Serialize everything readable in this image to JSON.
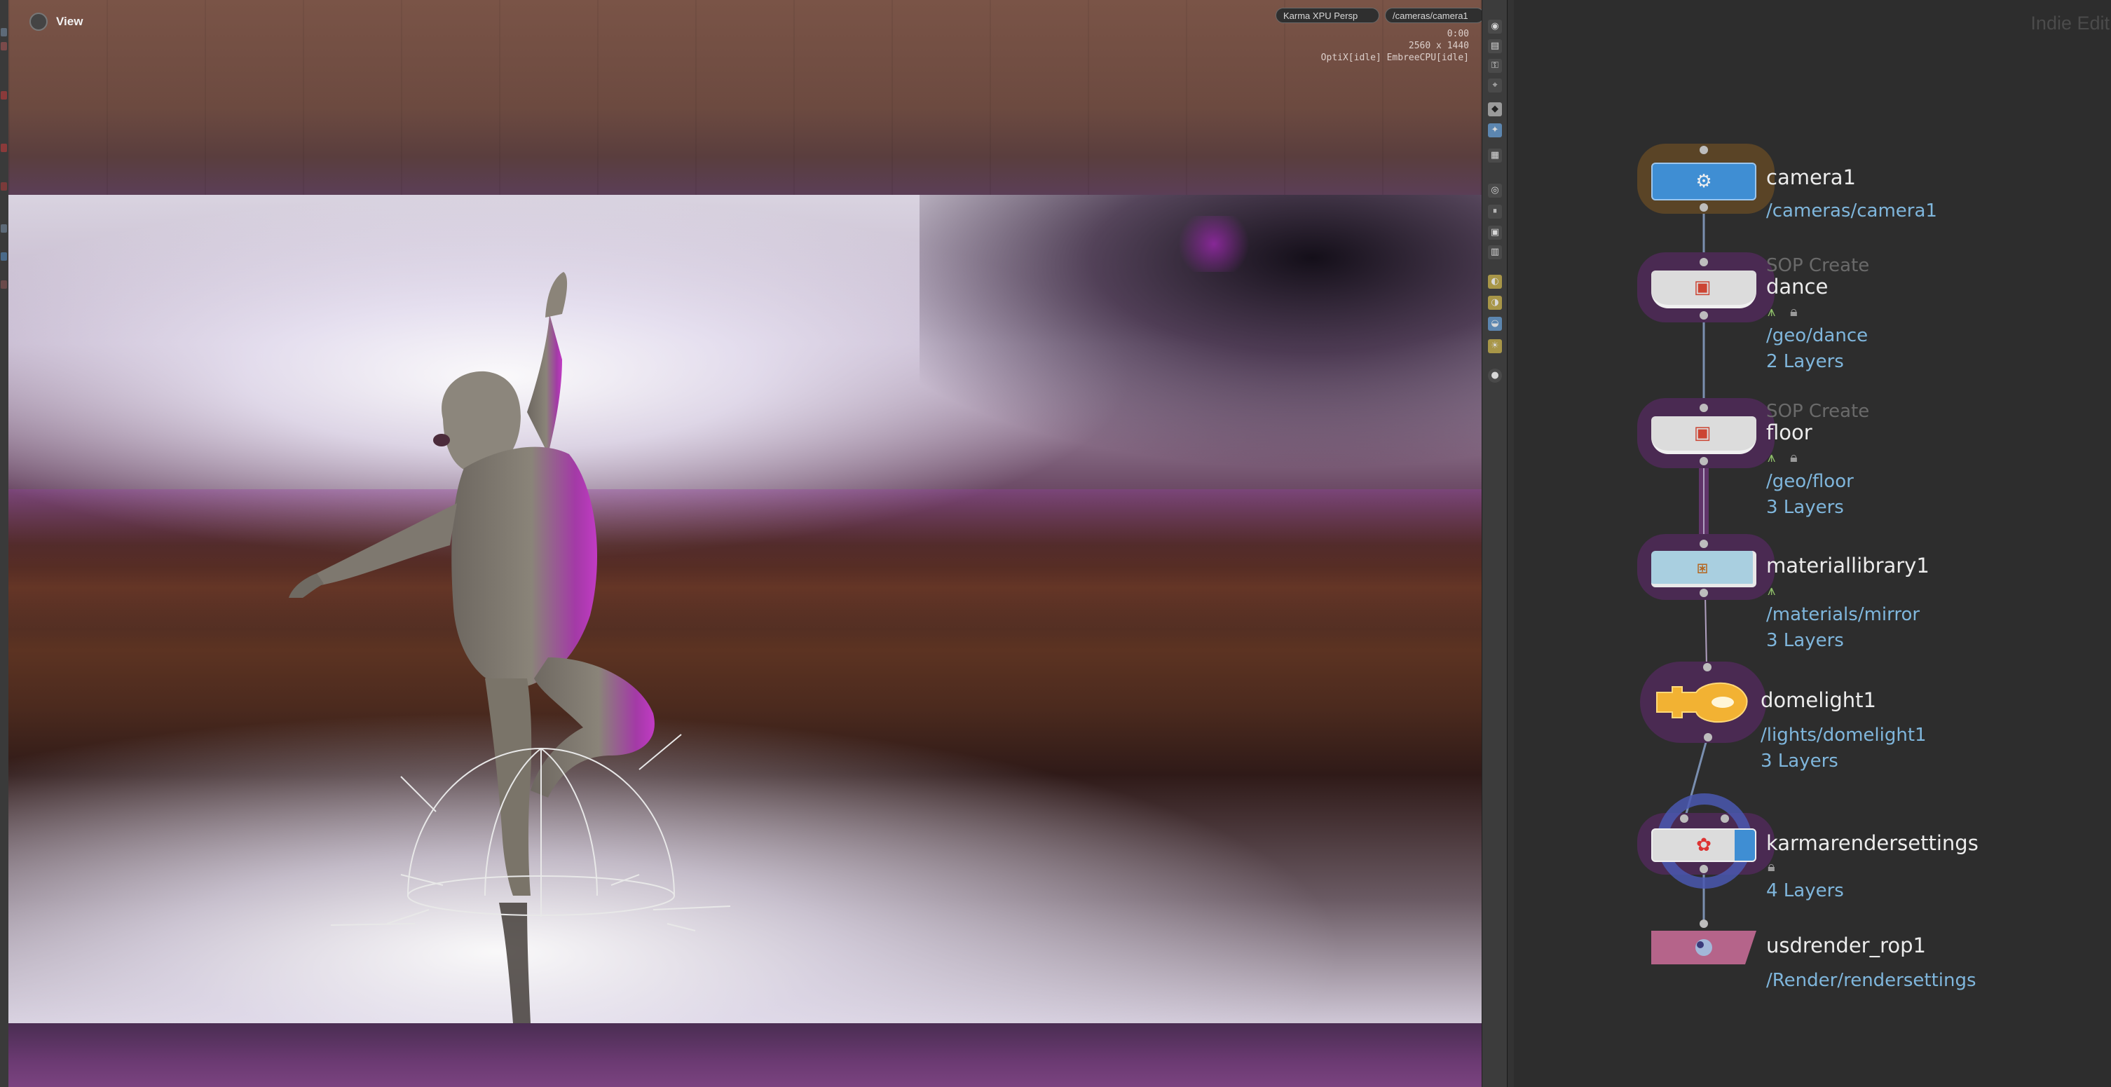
{
  "viewport": {
    "title": "View",
    "renderer_label": "Karma XPU  Persp",
    "camera_label": "/cameras/camera1",
    "stats": [
      "0:00",
      "2560 x 1440",
      "OptiX[idle] EmbreeCPU[idle]"
    ]
  },
  "network": {
    "watermark": "Indie Edit",
    "nodes": [
      {
        "name": "camera1",
        "path": "/cameras/camera1",
        "type_label": "",
        "layers": "",
        "color": "#3f8ed3"
      },
      {
        "name": "dance",
        "type_label": "SOP Create",
        "path": "/geo/dance",
        "layers": "2 Layers",
        "color": "#d9d9d9"
      },
      {
        "name": "floor",
        "type_label": "SOP Create",
        "path": "/geo/floor",
        "layers": "3 Layers",
        "color": "#d9d9d9"
      },
      {
        "name": "materiallibrary1",
        "type_label": "",
        "path": "/materials/mirror",
        "layers": "3 Layers",
        "color": "#a9cfe0"
      },
      {
        "name": "domelight1",
        "type_label": "",
        "path": "/lights/domelight1",
        "layers": "3 Layers",
        "color": "#f2b233"
      },
      {
        "name": "karmarendersettings",
        "type_label": "",
        "path": "",
        "layers": "4 Layers",
        "color": "#d9d9d9"
      },
      {
        "name": "usdrender_rop1",
        "type_label": "",
        "path": "/Render/rendersettings",
        "layers": "",
        "color": "#b5648a"
      }
    ]
  },
  "icons": {
    "viewport": "view-icon",
    "camera": "camera-node-icon",
    "sop": "sop-create-icon",
    "material": "material-library-icon",
    "light": "dome-light-icon",
    "render": "render-settings-icon",
    "rop": "usd-render-icon"
  }
}
